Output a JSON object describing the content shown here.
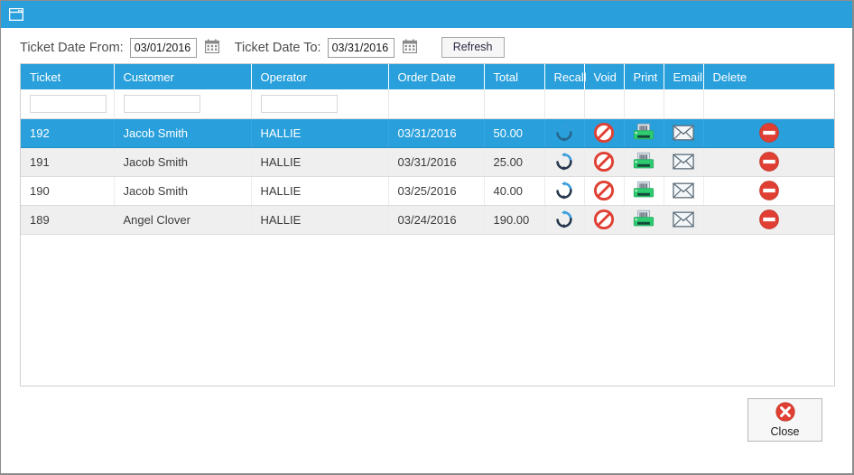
{
  "window": {
    "title_icon": "window-form-icon",
    "accent_color": "#29a0dc",
    "title": ""
  },
  "filters": {
    "date_from_label": "Ticket Date From:",
    "date_from_value": "03/01/2016",
    "date_from_calendar_icon": "calendar-icon",
    "date_to_label": "Ticket Date To:",
    "date_to_value": "03/31/2016",
    "date_to_calendar_icon": "calendar-icon",
    "refresh_label": "Refresh"
  },
  "grid": {
    "columns": [
      {
        "label": "Ticket",
        "key": "ticket"
      },
      {
        "label": "Customer",
        "key": "customer"
      },
      {
        "label": "Operator",
        "key": "operator"
      },
      {
        "label": "Order Date",
        "key": "order_date"
      },
      {
        "label": "Total",
        "key": "total"
      },
      {
        "label": "Recall",
        "key": "recall"
      },
      {
        "label": "Void",
        "key": "void"
      },
      {
        "label": "Print",
        "key": "print"
      },
      {
        "label": "Email",
        "key": "email"
      },
      {
        "label": "Delete",
        "key": "delete"
      }
    ],
    "filter_row": {
      "ticket_value": "",
      "ticket_placeholder": "",
      "customer_value": "",
      "customer_placeholder": "",
      "operator_value": "",
      "operator_placeholder": ""
    },
    "action_icons": {
      "recall": "recall-refresh-icon",
      "void": "void-prohibited-icon",
      "print": "printer-icon",
      "email": "envelope-icon",
      "delete": "delete-no-entry-icon"
    },
    "rows": [
      {
        "ticket": "192",
        "customer": "Jacob Smith",
        "operator": "HALLIE",
        "order_date": "03/31/2016",
        "total": "50.00",
        "selected": true
      },
      {
        "ticket": "191",
        "customer": "Jacob Smith",
        "operator": "HALLIE",
        "order_date": "03/31/2016",
        "total": "25.00",
        "selected": false
      },
      {
        "ticket": "190",
        "customer": "Jacob Smith",
        "operator": "HALLIE",
        "order_date": "03/25/2016",
        "total": "40.00",
        "selected": false
      },
      {
        "ticket": "189",
        "customer": "Angel Clover",
        "operator": "HALLIE",
        "order_date": "03/24/2016",
        "total": "190.00",
        "selected": false
      }
    ]
  },
  "footer": {
    "close_label": "Close",
    "close_icon": "close-circle-x-icon"
  }
}
